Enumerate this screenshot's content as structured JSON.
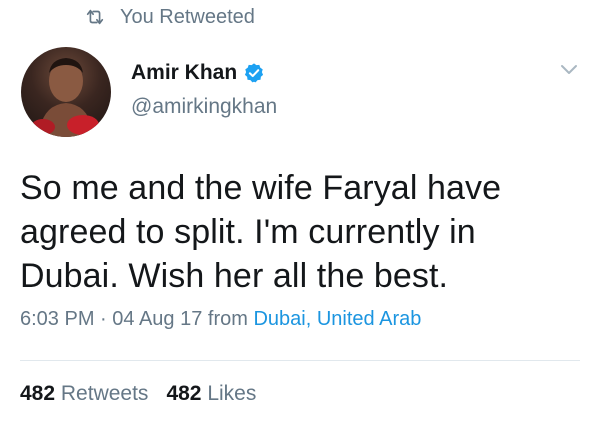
{
  "retweet_bar": {
    "icon": "retweet-icon",
    "label": "You Retweeted"
  },
  "author": {
    "avatar": "profile-photo",
    "display_name": "Amir Khan",
    "verified_icon": "verified-badge-icon",
    "handle": "@amirkingkhan"
  },
  "menu": {
    "icon": "chevron-down-icon"
  },
  "tweet": {
    "text": "So me and the wife Faryal have agreed to split. I'm currently in Dubai. Wish her all the best.",
    "timestamp": "6:03 PM · 04 Aug 17",
    "from_label": "from",
    "place": "Dubai, United Arab"
  },
  "stats": {
    "retweets_count": "482",
    "retweets_label": "Retweets",
    "likes_count": "482",
    "likes_label": "Likes"
  },
  "colors": {
    "secondary_text": "#657786",
    "link": "#1b95e0",
    "verified": "#1da1f2",
    "divider": "#e1e8ed"
  }
}
